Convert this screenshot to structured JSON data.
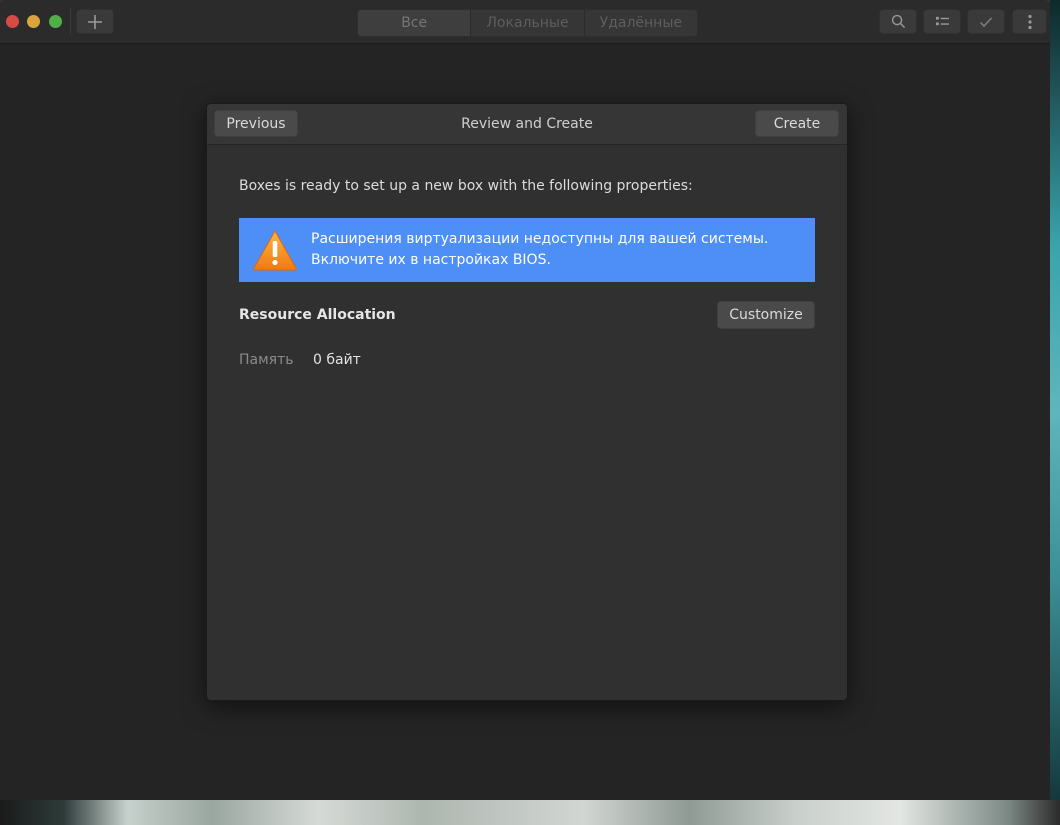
{
  "headerbar": {
    "view_tabs": [
      "Все",
      "Локальные",
      "Удалённые"
    ],
    "active_tab": 0
  },
  "dialog": {
    "title": "Review and Create",
    "previous_label": "Previous",
    "create_label": "Create",
    "intro": "Boxes is ready to set up a new box with the following properties:",
    "warning": {
      "line1": "Расширения виртуализации недоступны для вашей системы.",
      "line2": "Включите их в настройках BIOS."
    },
    "resource_title": "Resource Allocation",
    "customize_label": "Customize",
    "memory": {
      "label": "Память",
      "value": "0 байт"
    }
  },
  "colors": {
    "accent_info": "#4d8ef7",
    "warning_icon": "#f08a1c",
    "dialog_bg": "#303030",
    "window_bg": "#242424"
  },
  "icons": [
    "plus-icon",
    "search-icon",
    "list-view-icon",
    "checkmark-icon",
    "kebab-menu-icon",
    "warning-triangle-icon"
  ]
}
